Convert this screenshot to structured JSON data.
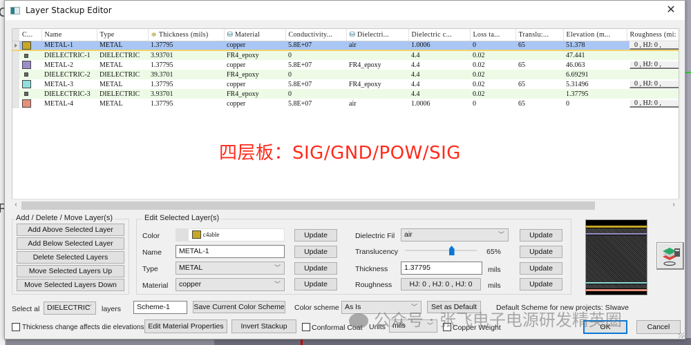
{
  "window": {
    "title": "Layer Stackup Editor",
    "close_label": "✕"
  },
  "table": {
    "columns": [
      "C...",
      "Name",
      "Type",
      "Thickness (mils)",
      "Material",
      "Conductivity...",
      "Dielectri...",
      "Dielectric c...",
      "Loss ta...",
      "Translu:...",
      "Elevation (m...",
      "Roughness (mi:"
    ],
    "rows": [
      {
        "color": "#c8a824",
        "name": "METAL-1",
        "type": "METAL",
        "thickness": "1.37795",
        "material": "copper",
        "conductivity": "5.8E+07",
        "dielectric_fill": "air",
        "dielectric_const": "1.0006",
        "loss_tangent": "0",
        "translucency": "65",
        "elevation": "51.378",
        "roughness": "0 , HJ: 0 ,",
        "selected": true,
        "kind": "metal"
      },
      {
        "color": "#666666",
        "name": "DIELECTRIC-1",
        "type": "DIELECTRIC",
        "thickness": "3.93701",
        "material": "FR4_epoxy",
        "conductivity": "0",
        "dielectric_fill": "",
        "dielectric_const": "4.4",
        "loss_tangent": "0.02",
        "translucency": "",
        "elevation": "47.441",
        "roughness": "",
        "selected": false,
        "kind": "diel"
      },
      {
        "color": "#9b8ec9",
        "name": "METAL-2",
        "type": "METAL",
        "thickness": "1.37795",
        "material": "copper",
        "conductivity": "5.8E+07",
        "dielectric_fill": "FR4_epoxy",
        "dielectric_const": "4.4",
        "loss_tangent": "0.02",
        "translucency": "65",
        "elevation": "46.063",
        "roughness": "0 , HJ: 0 ,",
        "selected": false,
        "kind": "metal"
      },
      {
        "color": "#666666",
        "name": "DIELECTRIC-2",
        "type": "DIELECTRIC",
        "thickness": "39.3701",
        "material": "FR4_epoxy",
        "conductivity": "0",
        "dielectric_fill": "",
        "dielectric_const": "4.4",
        "loss_tangent": "0.02",
        "translucency": "",
        "elevation": "6.69291",
        "roughness": "",
        "selected": false,
        "kind": "diel"
      },
      {
        "color": "#8ee0dc",
        "name": "METAL-3",
        "type": "METAL",
        "thickness": "1.37795",
        "material": "copper",
        "conductivity": "5.8E+07",
        "dielectric_fill": "FR4_epoxy",
        "dielectric_const": "4.4",
        "loss_tangent": "0.02",
        "translucency": "65",
        "elevation": "5.31496",
        "roughness": "0 , HJ: 0 ,",
        "selected": false,
        "kind": "metal"
      },
      {
        "color": "#666666",
        "name": "DIELECTRIC-3",
        "type": "DIELECTRIC",
        "thickness": "3.93701",
        "material": "FR4_epoxy",
        "conductivity": "0",
        "dielectric_fill": "",
        "dielectric_const": "4.4",
        "loss_tangent": "0.02",
        "translucency": "",
        "elevation": "1.37795",
        "roughness": "",
        "selected": false,
        "kind": "diel"
      },
      {
        "color": "#e8907a",
        "name": "METAL-4",
        "type": "METAL",
        "thickness": "1.37795",
        "material": "copper",
        "conductivity": "5.8E+07",
        "dielectric_fill": "air",
        "dielectric_const": "1.0006",
        "loss_tangent": "0",
        "translucency": "65",
        "elevation": "0",
        "roughness": "0 , HJ: 0 ,",
        "selected": false,
        "kind": "metal"
      }
    ]
  },
  "annotation": "四层板：SIG/GND/POW/SIG",
  "add_delete_group": {
    "label": "Add / Delete / Move Layer(s)",
    "buttons": [
      "Add Above Selected Layer",
      "Add Below Selected Layer",
      "Delete Selected Layers",
      "Move Selected Layers Up",
      "Move Selected Layers Down"
    ]
  },
  "edit_group": {
    "label": "Edit Selected Layer(s)",
    "color_label": "Color",
    "color_value": "c4able",
    "color_hex": "#c8a824",
    "name_label": "Name",
    "name_value": "METAL-1",
    "type_label": "Type",
    "type_value": "METAL",
    "material_label": "Material",
    "material_value": "copper",
    "update_label": "Update",
    "dielectric_fill_label": "Dielectric Fil",
    "dielectric_fill_value": "air",
    "translucency_label": "Translucency",
    "translucency_value": "65%",
    "translucency_fraction": 0.65,
    "thickness_label": "Thickness",
    "thickness_value": "1.37795",
    "thickness_unit": "mils",
    "roughness_label": "Roughness",
    "roughness_value": "HJ: 0 , HJ: 0 , HJ: 0",
    "roughness_unit": "mils"
  },
  "bottom": {
    "select_all_label": "Select al",
    "select_all_value": "DIELECTRIC",
    "layers_label": "layers",
    "scheme_name": "Scheme-1",
    "save_scheme_label": "Save Current Color Scheme",
    "color_scheme_label": "Color scheme",
    "color_scheme_value": "As Is",
    "set_default_label": "Set as Default",
    "default_scheme_text": "Default Scheme for new projects: SIwave",
    "thickness_checkbox_label": "Thickness change affects die elevations",
    "edit_material_label": "Edit Material Properties",
    "invert_stackup_label": "Invert Stackup",
    "conformal_coat_label": "Conformal Coat",
    "units_label": "Units",
    "units_value": "mils",
    "copper_weight_label": "Copper Weight",
    "ok_label": "OK",
    "cancel_label": "Cancel"
  },
  "watermark": "公众号 · 张飞电子电源研发精英圈",
  "scroll": {
    "left": "‹",
    "right": "›"
  },
  "icons": {
    "chevron": "﹀"
  }
}
